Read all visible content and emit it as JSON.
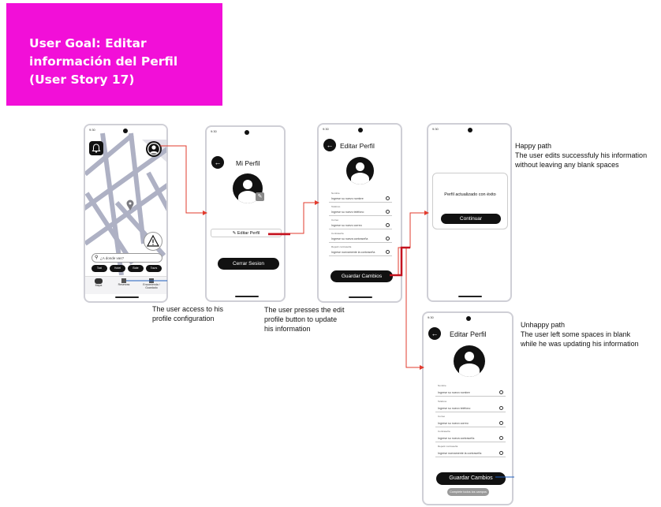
{
  "goal": {
    "title": "User Goal: Editar información del Perfil (User Story 17)",
    "color": "#f20fd8"
  },
  "status_bar": {
    "time": "9:30",
    "icons": "▾◢▮"
  },
  "screen_map": {
    "search_placeholder": "¿A donde vas?",
    "chips": [
      "Taxi",
      "Hotel",
      "Bote",
      "Tours"
    ],
    "nav": [
      "Mapa",
      "Reservas",
      "Encomienda / Guardado"
    ],
    "bell_icon": "bell-icon",
    "warning_icon": "warning-icon"
  },
  "screen_profile": {
    "title": "Mi Perfil",
    "edit_label": "✎ Editar Perfil",
    "logout_label": "Cerrar Sesion"
  },
  "screen_edit": {
    "title": "Editar Perfil",
    "fields": [
      {
        "label": "Nombre",
        "placeholder": "Ingrese su nuevo nombre"
      },
      {
        "label": "Teléfono",
        "placeholder": "Ingrese su nuevo teléfono"
      },
      {
        "label": "Correo",
        "placeholder": "Ingrese su nuevo correo"
      },
      {
        "label": "Contraseña",
        "placeholder": "Ingrese su nueva contraseña"
      },
      {
        "label": "Repetir contraseña",
        "placeholder": "Ingrese nuevamente la contraseña"
      }
    ],
    "save_label": "Guardar Cambios"
  },
  "screen_success": {
    "message": "Perfil actualizado con éxito",
    "continue_label": "Continuar"
  },
  "screen_error": {
    "title": "Editar Perfil",
    "fields": [
      {
        "label": "Nombre",
        "placeholder": "Ingrese su nuevo nombre"
      },
      {
        "label": "Teléfono",
        "placeholder": "Ingrese su nuevo teléfono"
      },
      {
        "label": "Correo",
        "placeholder": "Ingrese su nuevo correo"
      },
      {
        "label": "Contraseña",
        "placeholder": "Ingrese su nueva contraseña"
      },
      {
        "label": "Repetir contraseña",
        "placeholder": "Ingrese nuevamente la contraseña"
      }
    ],
    "save_label": "Guardar Cambios",
    "toast": "Complete todos los campos"
  },
  "annotations": {
    "step1_line1": "The user access to his",
    "step1_line2": "profile configuration",
    "step2_line1": "The user presses the edit",
    "step2_line2": "profile button to update",
    "step2_line3": "his information",
    "happy_line1": "Happy path",
    "happy_line2": "The user edits successfuly his information",
    "happy_line3": "without leaving any blank spaces",
    "unhappy_line1": "Unhappy path",
    "unhappy_line2": "The user left some spaces in blank",
    "unhappy_line3": "while he was updating his information"
  },
  "colors": {
    "arrow": "#e23b2e",
    "highlight_line": "#c4121f",
    "note_line": "#1f5fbf",
    "map_street": "#aeb1c4"
  }
}
